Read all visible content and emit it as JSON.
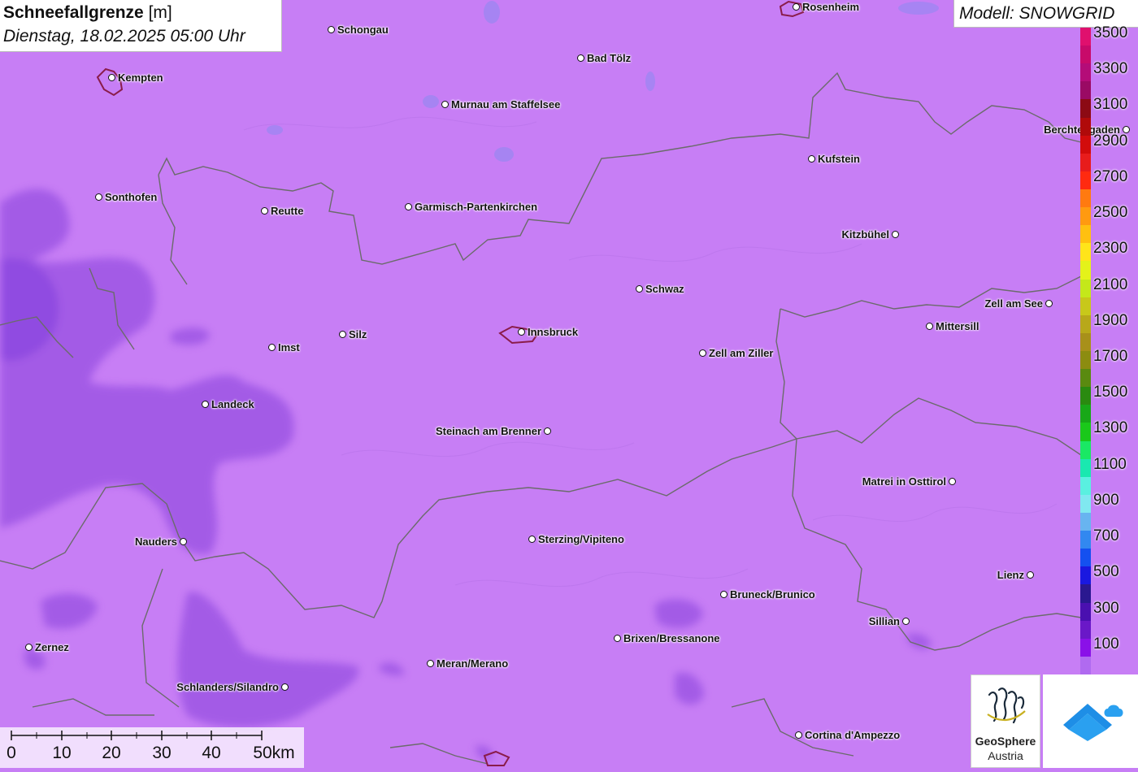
{
  "header": {
    "title_bold": "Schneefallgrenze",
    "title_unit": "[m]",
    "datetime": "Dienstag, 18.02.2025 05:00 Uhr",
    "model": "Modell: SNOWGRID"
  },
  "legend": {
    "unit": "m",
    "entries": [
      {
        "label": "3500",
        "color": "#e0106e"
      },
      {
        "label": "",
        "color": "#c80a6a"
      },
      {
        "label": "3300",
        "color": "#b40c78"
      },
      {
        "label": "",
        "color": "#9a0a64"
      },
      {
        "label": "3100",
        "color": "#8c0a14"
      },
      {
        "label": "",
        "color": "#b00a0a"
      },
      {
        "label": "2900",
        "color": "#d20c0c"
      },
      {
        "label": "",
        "color": "#e81c1c"
      },
      {
        "label": "2700",
        "color": "#ff2a10"
      },
      {
        "label": "",
        "color": "#ff7a10"
      },
      {
        "label": "2500",
        "color": "#ff9a10"
      },
      {
        "label": "",
        "color": "#ffc010"
      },
      {
        "label": "2300",
        "color": "#ffe41a"
      },
      {
        "label": "",
        "color": "#e4f21a"
      },
      {
        "label": "2100",
        "color": "#c4e81a"
      },
      {
        "label": "",
        "color": "#c8c81a"
      },
      {
        "label": "1900",
        "color": "#b8a81a"
      },
      {
        "label": "",
        "color": "#a8901a"
      },
      {
        "label": "1700",
        "color": "#8c8c10"
      },
      {
        "label": "",
        "color": "#5a8a10"
      },
      {
        "label": "1500",
        "color": "#2a8a10"
      },
      {
        "label": "",
        "color": "#18a818"
      },
      {
        "label": "1300",
        "color": "#1ac81a"
      },
      {
        "label": "",
        "color": "#1ae864"
      },
      {
        "label": "1100",
        "color": "#1ae8b0"
      },
      {
        "label": "",
        "color": "#5af0e0"
      },
      {
        "label": "900",
        "color": "#80e8f0"
      },
      {
        "label": "",
        "color": "#68b4f0"
      },
      {
        "label": "700",
        "color": "#3288f0"
      },
      {
        "label": "",
        "color": "#1450f0"
      },
      {
        "label": "500",
        "color": "#1a18e0"
      },
      {
        "label": "",
        "color": "#2a1890"
      },
      {
        "label": "300",
        "color": "#4a10b0"
      },
      {
        "label": "",
        "color": "#6a18c8"
      },
      {
        "label": "100",
        "color": "#8a10e8"
      },
      {
        "label": "",
        "color": "#b06af0"
      }
    ]
  },
  "scale_bar": {
    "ticks": [
      "0",
      "10",
      "20",
      "30",
      "40",
      "50km"
    ]
  },
  "cities": [
    {
      "name": "Rosenheim",
      "side": "right"
    },
    {
      "name": "Schongau",
      "side": "right"
    },
    {
      "name": "Bad Tölz",
      "side": "right"
    },
    {
      "name": "Kempten",
      "side": "right"
    },
    {
      "name": "Murnau am Staffelsee",
      "side": "right"
    },
    {
      "name": "Berchtesgaden",
      "side": "left"
    },
    {
      "name": "Kufstein",
      "side": "right"
    },
    {
      "name": "Sonthofen",
      "side": "right"
    },
    {
      "name": "Reutte",
      "side": "right"
    },
    {
      "name": "Garmisch-Partenkirchen",
      "side": "right"
    },
    {
      "name": "Kitzbühel",
      "side": "left"
    },
    {
      "name": "Schwaz",
      "side": "right"
    },
    {
      "name": "Zell am See",
      "side": "left"
    },
    {
      "name": "Mittersill",
      "side": "right"
    },
    {
      "name": "Silz",
      "side": "right"
    },
    {
      "name": "Innsbruck",
      "side": "right"
    },
    {
      "name": "Imst",
      "side": "right"
    },
    {
      "name": "Zell am Ziller",
      "side": "right"
    },
    {
      "name": "Landeck",
      "side": "right"
    },
    {
      "name": "Steinach am Brenner",
      "side": "left"
    },
    {
      "name": "Matrei in Osttirol",
      "side": "left"
    },
    {
      "name": "Nauders",
      "side": "left"
    },
    {
      "name": "Sterzing/Vipiteno",
      "side": "right"
    },
    {
      "name": "Lienz",
      "side": "left"
    },
    {
      "name": "Bruneck/Brunico",
      "side": "right"
    },
    {
      "name": "Sillian",
      "side": "left"
    },
    {
      "name": "Brixen/Bressanone",
      "side": "right"
    },
    {
      "name": "Zernez",
      "side": "right"
    },
    {
      "name": "Meran/Merano",
      "side": "right"
    },
    {
      "name": "Schlanders/Silandro",
      "side": "left"
    },
    {
      "name": "Cortina d'Ampezzo",
      "side": "right"
    }
  ],
  "logos": {
    "geosphere_line1": "GeoSphere",
    "geosphere_line2": "Austria"
  }
}
